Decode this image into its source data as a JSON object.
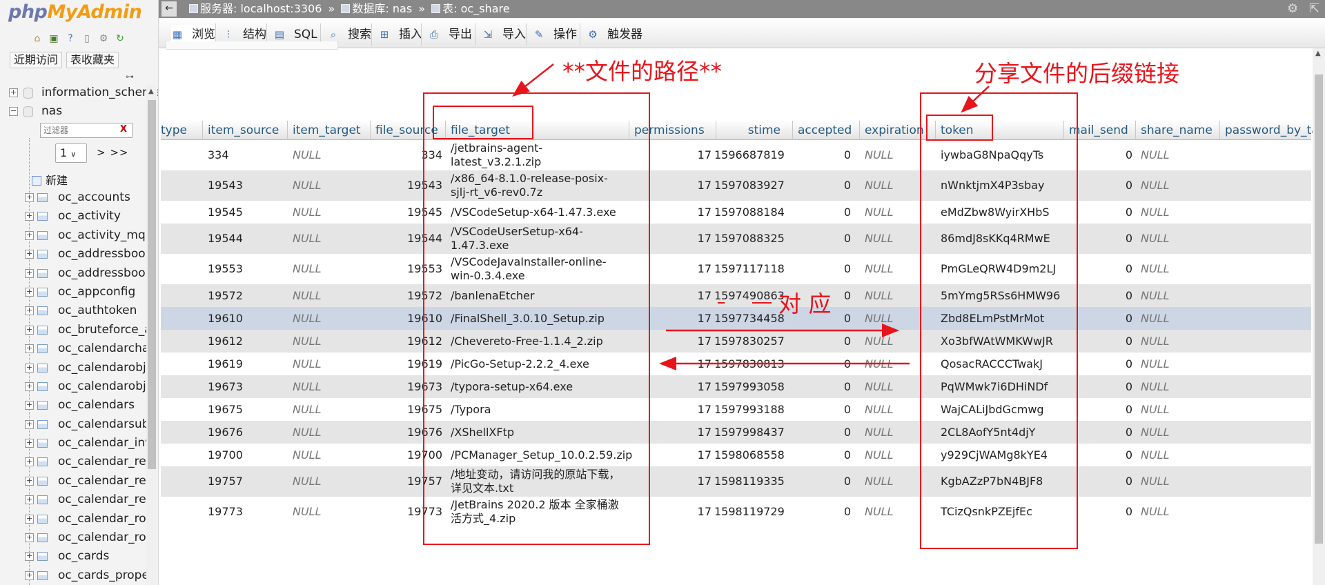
{
  "sidebar": {
    "logo": {
      "php": "php",
      "my": "My",
      "admin": "Admin"
    },
    "logo_icons": [
      "home-icon",
      "database-icon",
      "help-icon",
      "docs-icon",
      "settings-icon",
      "reload-icon"
    ],
    "recent_label": "近期访问",
    "favorites_label": "表收藏夹",
    "databases": [
      {
        "name": "information_schema",
        "expanded": false
      },
      {
        "name": "nas",
        "expanded": true
      }
    ],
    "filter_placeholder": "过滤器",
    "filter_clear": "X",
    "page_value": "1",
    "page_nav": "> >>",
    "new_label": "新建",
    "tables": [
      "oc_accounts",
      "oc_activity",
      "oc_activity_mq",
      "oc_addressbook",
      "oc_addressbook",
      "oc_appconfig",
      "oc_authtoken",
      "oc_bruteforce_a",
      "oc_calendarchar",
      "oc_calendarobje",
      "oc_calendarobje",
      "oc_calendars",
      "oc_calendarsubs",
      "oc_calendar_inv",
      "oc_calendar_rem",
      "oc_calendar_res",
      "oc_calendar_res",
      "oc_calendar_roo",
      "oc_calendar_roo",
      "oc_cards",
      "oc_cards_proper"
    ]
  },
  "topbar": {
    "back": "←",
    "server_label": "服务器: localhost:3306",
    "db_label": "数据库: nas",
    "table_label": "表: oc_share",
    "separator": "»"
  },
  "tabs": [
    {
      "label": "浏览",
      "icon": "browse-icon",
      "glyph": "▦",
      "active": true
    },
    {
      "label": "结构",
      "icon": "structure-icon",
      "glyph": "⫶",
      "active": false
    },
    {
      "label": "SQL",
      "icon": "sql-icon",
      "glyph": "▤",
      "active": false
    },
    {
      "label": "搜索",
      "icon": "search-icon",
      "glyph": "⌕",
      "active": false
    },
    {
      "label": "插入",
      "icon": "insert-icon",
      "glyph": "⊞",
      "active": false
    },
    {
      "label": "导出",
      "icon": "export-icon",
      "glyph": "⎙",
      "active": false
    },
    {
      "label": "导入",
      "icon": "import-icon",
      "glyph": "⇲",
      "active": false
    },
    {
      "label": "操作",
      "icon": "wrench-icon",
      "glyph": "✎",
      "active": false
    },
    {
      "label": "触发器",
      "icon": "trigger-icon",
      "glyph": "⚙",
      "active": false
    }
  ],
  "table": {
    "columns": [
      "type",
      "item_source",
      "item_target",
      "file_source",
      "file_target",
      "permissions",
      "stime",
      "accepted",
      "expiration",
      "token",
      "mail_send",
      "share_name",
      "password_by_ta"
    ],
    "rows": [
      [
        "",
        "334",
        "NULL",
        "334",
        "/jetbrains-agent-latest_v3.2.1.zip",
        "17",
        "1596687819",
        "0",
        "NULL",
        "iywbaG8NpaQqyTs",
        "0",
        "NULL"
      ],
      [
        "",
        "19543",
        "NULL",
        "19543",
        "/x86_64-8.1.0-release-posix-sjlj-rt_v6-rev0.7z",
        "17",
        "1597083927",
        "0",
        "NULL",
        "nWnktjmX4P3sbay",
        "0",
        "NULL"
      ],
      [
        "",
        "19545",
        "NULL",
        "19545",
        "/VSCodeSetup-x64-1.47.3.exe",
        "17",
        "1597088184",
        "0",
        "NULL",
        "eMdZbw8WyirXHbS",
        "0",
        "NULL"
      ],
      [
        "",
        "19544",
        "NULL",
        "19544",
        "/VSCodeUserSetup-x64-1.47.3.exe",
        "17",
        "1597088325",
        "0",
        "NULL",
        "86mdJ8sKKq4RMwE",
        "0",
        "NULL"
      ],
      [
        "",
        "19553",
        "NULL",
        "19553",
        "/VSCodeJavaInstaller-online-win-0.3.4.exe",
        "17",
        "1597117118",
        "0",
        "NULL",
        "PmGLeQRW4D9m2LJ",
        "0",
        "NULL"
      ],
      [
        "",
        "19572",
        "NULL",
        "19572",
        "/banlenaEtcher",
        "17",
        "1597490863",
        "0",
        "NULL",
        "5mYmg5RSs6HMW96",
        "0",
        "NULL"
      ],
      [
        "",
        "19610",
        "NULL",
        "19610",
        "/FinalShell_3.0.10_Setup.zip",
        "17",
        "1597734458",
        "0",
        "NULL",
        "Zbd8ELmPstMrMot",
        "0",
        "NULL"
      ],
      [
        "",
        "19612",
        "NULL",
        "19612",
        "/Chevereto-Free-1.1.4_2.zip",
        "17",
        "1597830257",
        "0",
        "NULL",
        "Xo3bfWAtWMKWwJR",
        "0",
        "NULL"
      ],
      [
        "",
        "19619",
        "NULL",
        "19619",
        "/PicGo-Setup-2.2.2_4.exe",
        "17",
        "1597830813",
        "0",
        "NULL",
        "QosacRACCCTwakJ",
        "0",
        "NULL"
      ],
      [
        "",
        "19673",
        "NULL",
        "19673",
        "/typora-setup-x64.exe",
        "17",
        "1597993058",
        "0",
        "NULL",
        "PqWMwk7i6DHiNDf",
        "0",
        "NULL"
      ],
      [
        "",
        "19675",
        "NULL",
        "19675",
        "/Typora",
        "17",
        "1597993188",
        "0",
        "NULL",
        "WajCALiJbdGcmwg",
        "0",
        "NULL"
      ],
      [
        "",
        "19676",
        "NULL",
        "19676",
        "/XShellXFtp",
        "17",
        "1597998437",
        "0",
        "NULL",
        "2CL8AofY5nt4djY",
        "0",
        "NULL"
      ],
      [
        "",
        "19700",
        "NULL",
        "19700",
        "/PCManager_Setup_10.0.2.59.zip",
        "17",
        "1598068558",
        "0",
        "NULL",
        "y929CjWAMg8kYE4",
        "0",
        "NULL"
      ],
      [
        "",
        "19757",
        "NULL",
        "19757",
        "/地址变动，请访问我的原站下载，详见文本.txt",
        "17",
        "1598119335",
        "0",
        "NULL",
        "KgbAZzP7bN4BJF8",
        "0",
        "NULL"
      ],
      [
        "",
        "19773",
        "NULL",
        "19773",
        "/JetBrains 2020.2 版本 全家桶激活方式_4.zip",
        "17",
        "1598119729",
        "0",
        "NULL",
        "TCizQsnkPZEjfEc",
        "0",
        "NULL"
      ]
    ]
  },
  "annotations": {
    "file_path": "**文件的路径**",
    "token_suffix": "分享文件的后缀链接",
    "correspond": "对 应",
    "color": "#e8141b"
  }
}
